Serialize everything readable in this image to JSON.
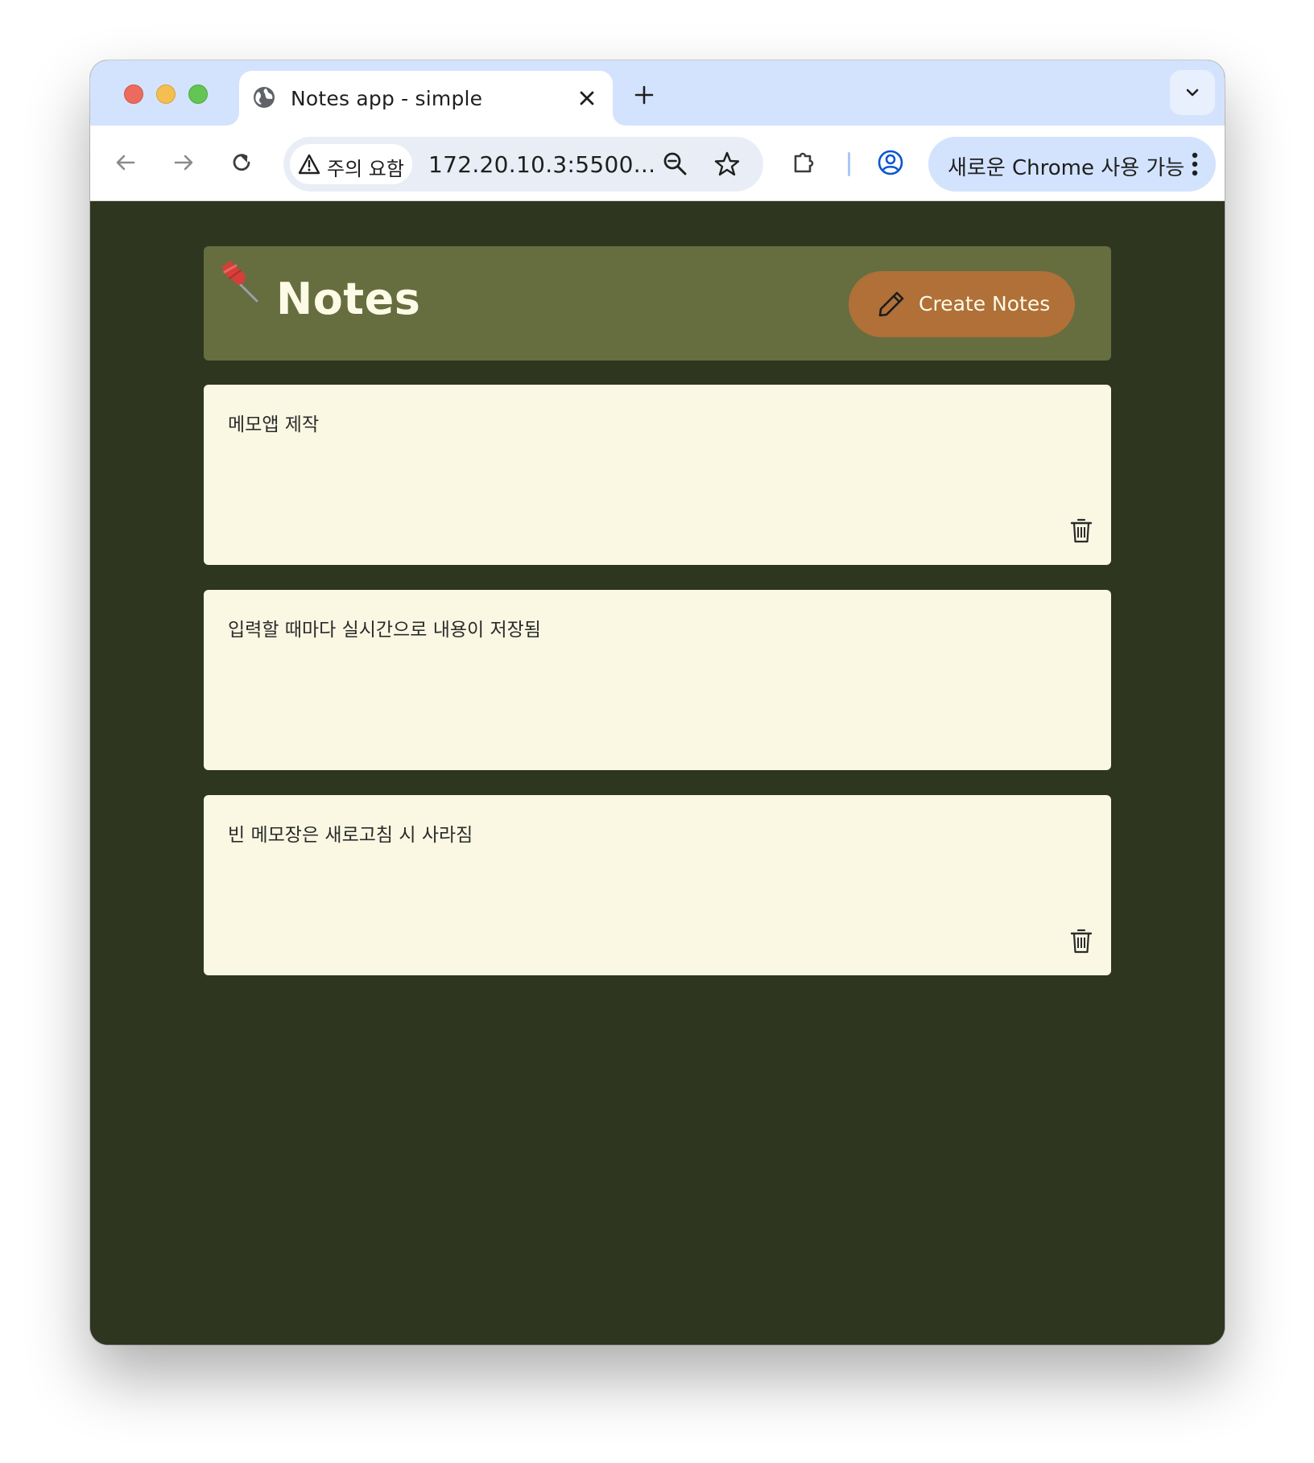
{
  "browser": {
    "tab_title": "Notes app - simple",
    "security_chip": "주의 요함",
    "url": "172.20.10.3:5500...",
    "update_button": "새로운 Chrome 사용 가능"
  },
  "app": {
    "title": "Notes",
    "create_button": "Create Notes",
    "colors": {
      "background": "#2e3620",
      "header": "#666e40",
      "button": "#b07038",
      "note": "#faf8e3"
    }
  },
  "notes": [
    {
      "text": "메모앱 제작",
      "show_delete": true
    },
    {
      "text": "입력할 때마다 실시간으로 내용이 저장됨",
      "show_delete": false
    },
    {
      "text": "빈 메모장은 새로고침 시 사라짐",
      "show_delete": true
    }
  ]
}
